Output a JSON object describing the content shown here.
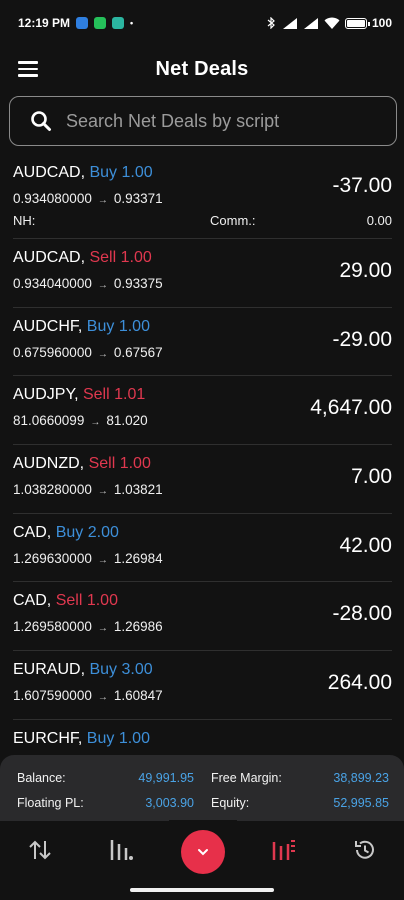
{
  "status_bar": {
    "time": "12:19 PM",
    "battery": "100"
  },
  "header": {
    "title": "Net Deals",
    "menu_icon": "hamburger-menu-icon"
  },
  "search": {
    "placeholder": "Search Net Deals by script",
    "value": ""
  },
  "deals": [
    {
      "symbol": "AUDCAD,",
      "side": "Buy",
      "volume": "1.00",
      "open_price": "0.934080000",
      "current_price": "0.93371",
      "pl": "-37.00",
      "nh_label": "NH:",
      "comm_label": "Comm.:",
      "comm_value": "0.00"
    },
    {
      "symbol": "AUDCAD,",
      "side": "Sell",
      "volume": "1.00",
      "open_price": "0.934040000",
      "current_price": "0.93375",
      "pl": "29.00"
    },
    {
      "symbol": "AUDCHF,",
      "side": "Buy",
      "volume": "1.00",
      "open_price": "0.675960000",
      "current_price": "0.67567",
      "pl": "-29.00"
    },
    {
      "symbol": "AUDJPY,",
      "side": "Sell",
      "volume": "1.01",
      "open_price": "81.0660099",
      "current_price": "81.020",
      "pl": "4,647.00"
    },
    {
      "symbol": "AUDNZD,",
      "side": "Sell",
      "volume": "1.00",
      "open_price": "1.038280000",
      "current_price": "1.03821",
      "pl": "7.00"
    },
    {
      "symbol": "CAD,",
      "side": "Buy",
      "volume": "2.00",
      "open_price": "1.269630000",
      "current_price": "1.26984",
      "pl": "42.00"
    },
    {
      "symbol": "CAD,",
      "side": "Sell",
      "volume": "1.00",
      "open_price": "1.269580000",
      "current_price": "1.26986",
      "pl": "-28.00"
    },
    {
      "symbol": "EURAUD,",
      "side": "Buy",
      "volume": "3.00",
      "open_price": "1.607590000",
      "current_price": "1.60847",
      "pl": "264.00"
    },
    {
      "symbol": "EURCHF,",
      "side": "Buy",
      "volume": "1.00",
      "open_price": "",
      "current_price": "",
      "pl": ""
    }
  ],
  "arrow_glyph": "→",
  "summary": {
    "balance_label": "Balance:",
    "balance_value": "49,991.95",
    "free_margin_label": "Free Margin:",
    "free_margin_value": "38,899.23",
    "floating_pl_label": "Floating PL:",
    "floating_pl_value": "3,003.90",
    "equity_label": "Equity:",
    "equity_value": "52,995.85"
  },
  "colors": {
    "buy": "#3d8fd9",
    "sell": "#e0384f",
    "accent": "#e7304a",
    "value_blue": "#4aa3e6"
  },
  "bottom_nav": [
    {
      "icon": "swap-arrows-icon",
      "active": false
    },
    {
      "icon": "bar-chart-icon",
      "active": false
    },
    {
      "icon": "chevron-down-icon",
      "active": false
    },
    {
      "icon": "net-deals-chart-icon",
      "active": true
    },
    {
      "icon": "history-icon",
      "active": false
    }
  ]
}
